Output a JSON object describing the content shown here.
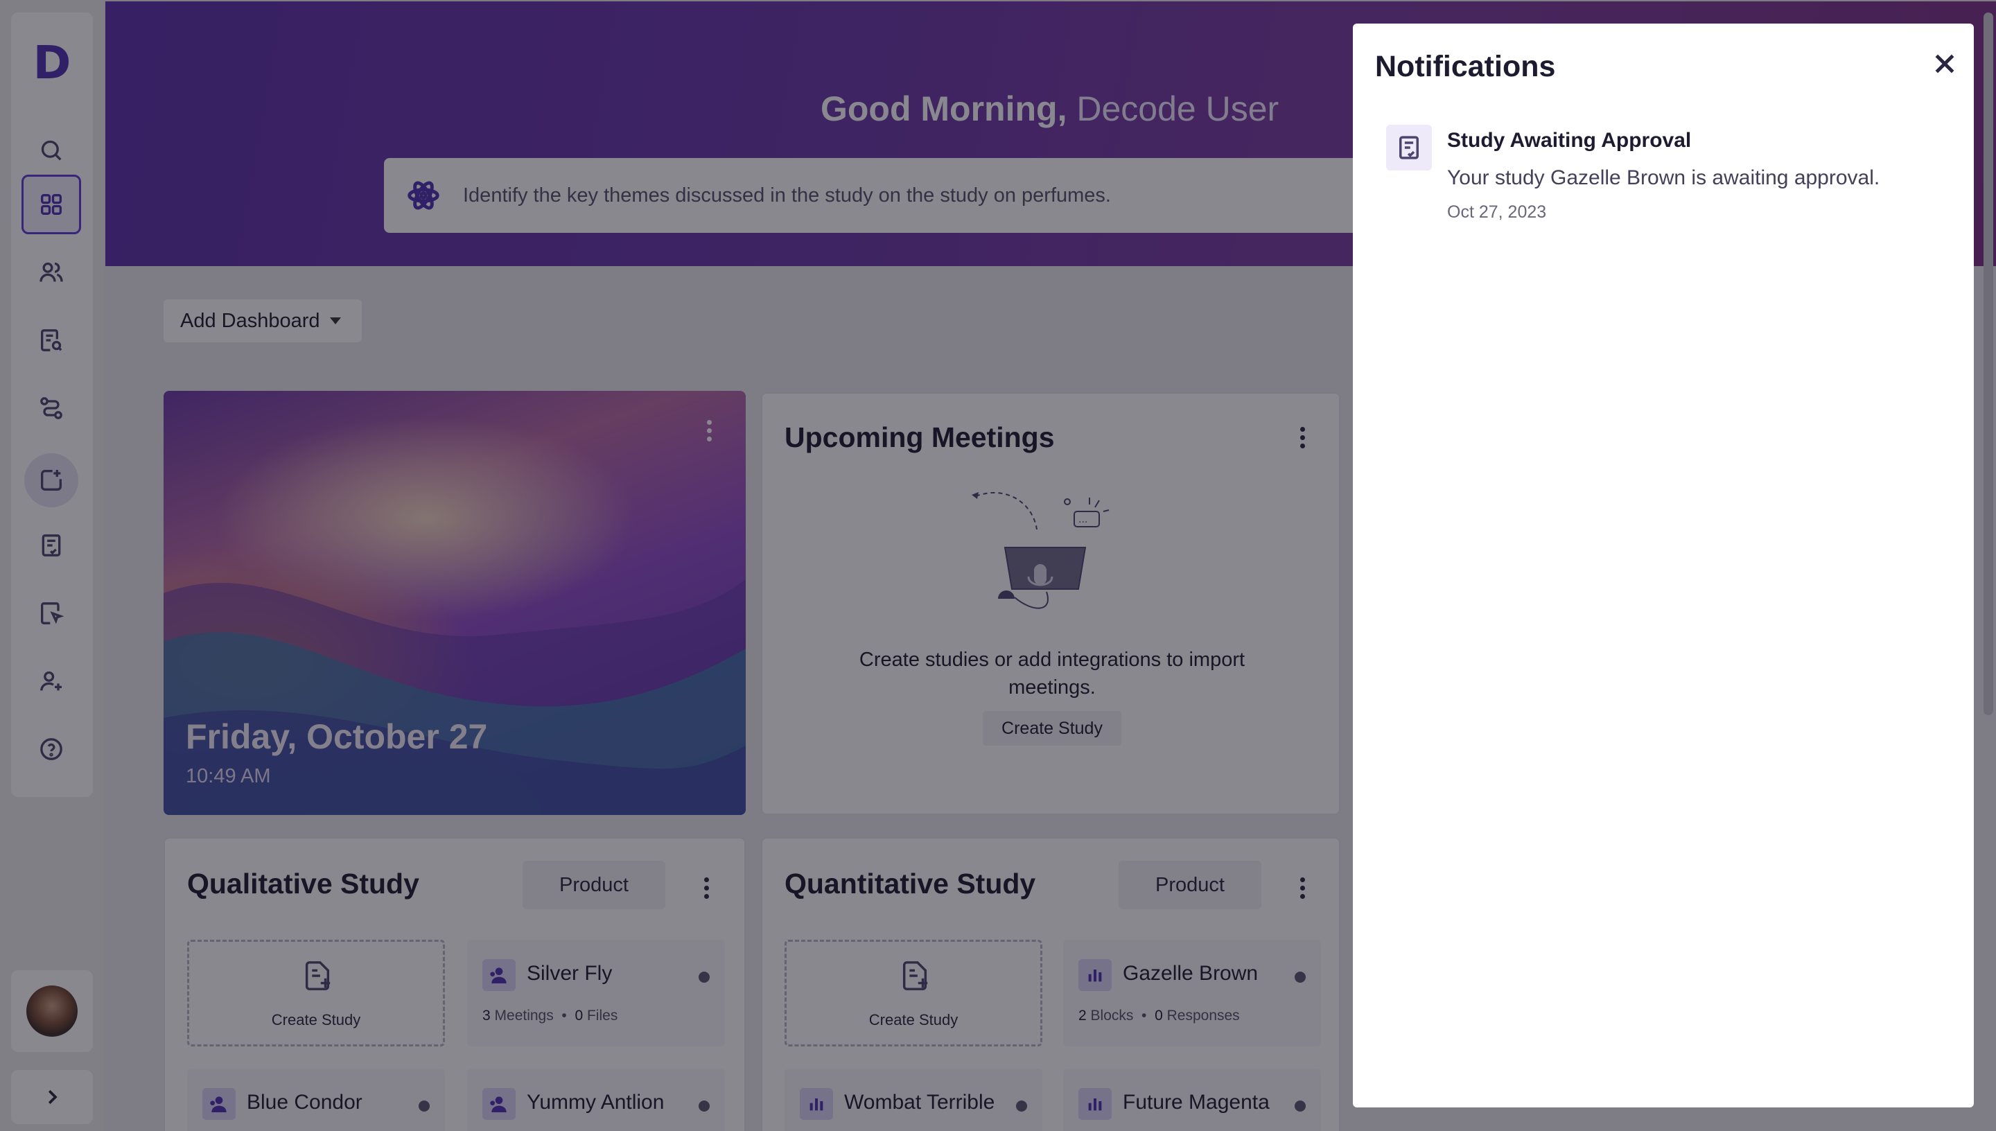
{
  "app": {
    "logo_letter": "D",
    "accent": "#4b2fb3"
  },
  "sidebar": {
    "items": [
      {
        "icon": "search-icon"
      },
      {
        "icon": "dashboard-grid-icon",
        "active": true
      },
      {
        "icon": "users-icon"
      },
      {
        "icon": "documents-search-icon"
      },
      {
        "icon": "workflow-icon"
      },
      {
        "icon": "add-study-icon"
      },
      {
        "icon": "report-icon"
      },
      {
        "icon": "cursor-document-icon"
      },
      {
        "icon": "add-user-icon"
      },
      {
        "icon": "help-icon"
      }
    ]
  },
  "hero": {
    "greeting": "Good Morning,",
    "user_name": "Decode User",
    "ask_text": "Identify the key themes discussed in the study on the study on perfumes."
  },
  "toolbar": {
    "add_dashboard": "Add Dashboard"
  },
  "clock_card": {
    "date": "Friday, October 27",
    "time": "10:49 AM"
  },
  "meetings_card": {
    "title": "Upcoming Meetings",
    "message": "Create studies or add integrations to import meetings.",
    "button": "Create Study"
  },
  "qualitative": {
    "title": "Qualitative Study",
    "filter": "Product",
    "create_label": "Create Study",
    "items": [
      {
        "name": "Silver Fly",
        "count1": "3",
        "label1": "Meetings",
        "count2": "0",
        "label2": "Files"
      },
      {
        "name": "Blue Condor"
      },
      {
        "name": "Yummy Antlion"
      }
    ]
  },
  "quantitative": {
    "title": "Quantitative Study",
    "filter": "Product",
    "create_label": "Create Study",
    "items": [
      {
        "name": "Gazelle Brown",
        "count1": "2",
        "label1": "Blocks",
        "count2": "0",
        "label2": "Responses"
      },
      {
        "name": "Wombat Terrible"
      },
      {
        "name": "Future Magenta"
      }
    ]
  },
  "notifications": {
    "title": "Notifications",
    "items": [
      {
        "title": "Study Awaiting Approval",
        "body": "Your study Gazelle Brown is awaiting approval.",
        "date": "Oct 27, 2023"
      }
    ]
  }
}
